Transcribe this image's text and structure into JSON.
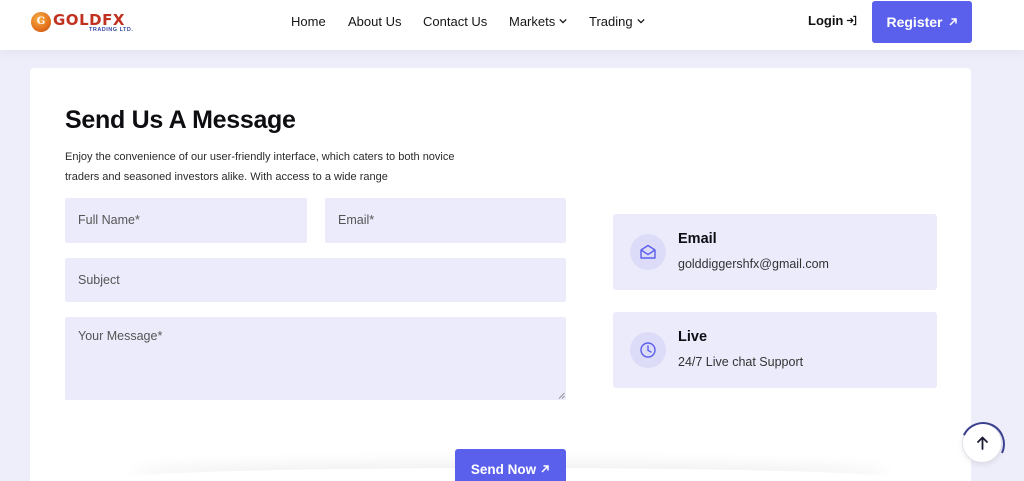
{
  "header": {
    "logo": {
      "mark": "G",
      "name": "GOLDFX",
      "tagline": "TRADING LTD."
    },
    "nav": [
      {
        "label": "Home",
        "has_dropdown": false
      },
      {
        "label": "About Us",
        "has_dropdown": false
      },
      {
        "label": "Contact Us",
        "has_dropdown": false
      },
      {
        "label": "Markets",
        "has_dropdown": true
      },
      {
        "label": "Trading",
        "has_dropdown": true
      }
    ],
    "login_label": "Login",
    "register_label": "Register"
  },
  "contact_form": {
    "title": "Send Us A Message",
    "description": "Enjoy the convenience of our user-friendly interface, which caters to both novice traders and seasoned investors alike. With access to a wide range",
    "fields": {
      "full_name_placeholder": "Full Name*",
      "email_placeholder": "Email*",
      "subject_placeholder": "Subject",
      "message_placeholder": "Your Message*"
    },
    "submit_label": "Send Now"
  },
  "contact_info": [
    {
      "icon": "envelope-icon",
      "title": "Email",
      "text": "golddiggershfx@gmail.com"
    },
    {
      "icon": "clock-icon",
      "title": "Live",
      "text": "24/7 Live chat Support"
    }
  ],
  "colors": {
    "accent": "#5b60ec",
    "page_background": "#eeeefb",
    "field_background": "#ecebfb",
    "logo_red": "#c0311f"
  }
}
